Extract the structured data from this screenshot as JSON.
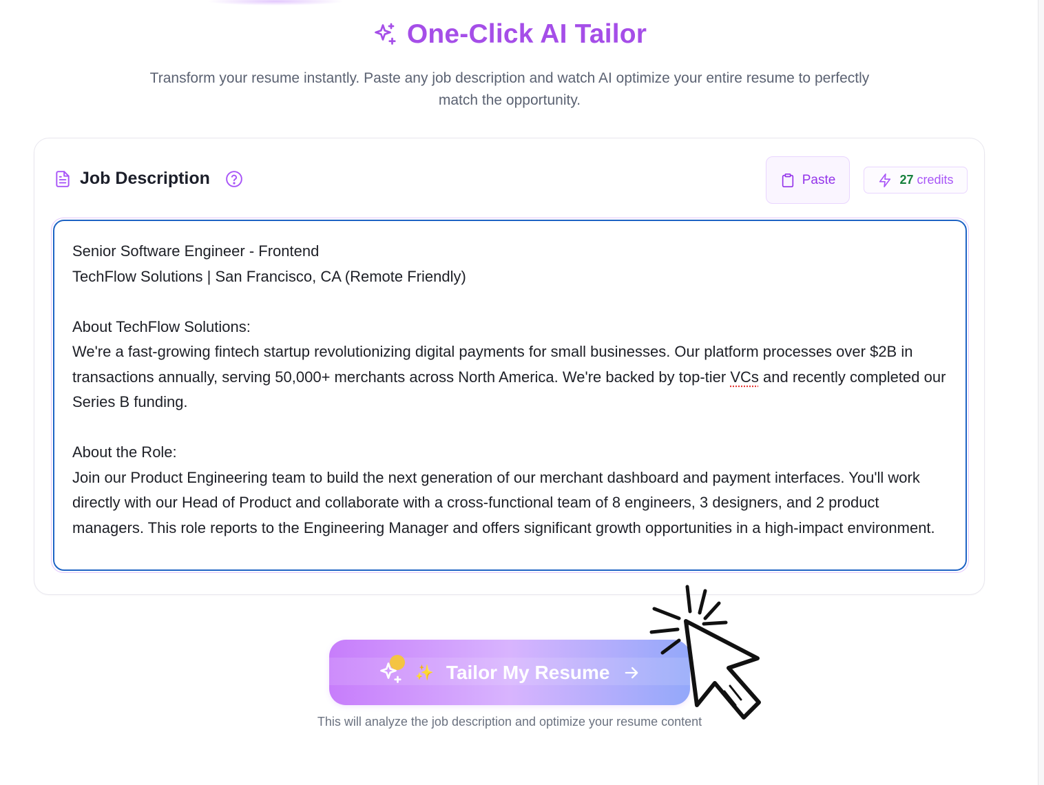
{
  "header": {
    "title": "One-Click AI Tailor",
    "subtitle": "Transform your resume instantly. Paste any job description and watch AI optimize your entire resume to perfectly match the opportunity.",
    "icon": "sparkles-icon",
    "accent_color": "#a54ee8"
  },
  "job_card": {
    "label": "Job Description",
    "paste_label": "Paste",
    "credits_count": "27",
    "credits_label": "credits",
    "textarea": {
      "line_1": "Senior Software Engineer - Frontend",
      "line_2": "TechFlow Solutions | San Francisco, CA (Remote Friendly)",
      "about_company_heading": "About TechFlow Solutions:",
      "about_company_pre": "We're a fast-growing fintech startup revolutionizing digital payments for small businesses. Our platform processes over $2B in transactions annually, serving 50,000+ merchants across North America. We're backed by top-tier ",
      "about_company_flagged": "VCs",
      "about_company_post": " and recently completed our Series B funding.",
      "about_role_heading": "About the Role:",
      "about_role_body": "Join our Product Engineering team to build the next generation of our merchant dashboard and payment interfaces. You'll work directly with our Head of Product and collaborate with a cross-functional team of 8 engineers, 3 designers, and 2 product managers. This role reports to the Engineering Manager and offers significant growth opportunities in a high-impact environment."
    },
    "focus_color": "#1d63c4"
  },
  "cta": {
    "spark": "✨",
    "label": "Tailor My Resume",
    "hint": "This will analyze the job description and optimize your resume content",
    "gradient": [
      "#c77dfb",
      "#d8b4fe",
      "#93a8fa"
    ]
  },
  "icons": [
    "sparkles-icon",
    "document-icon",
    "help-circle-icon",
    "clipboard-icon",
    "lightning-icon",
    "arrow-right-icon",
    "click-cursor-icon"
  ]
}
